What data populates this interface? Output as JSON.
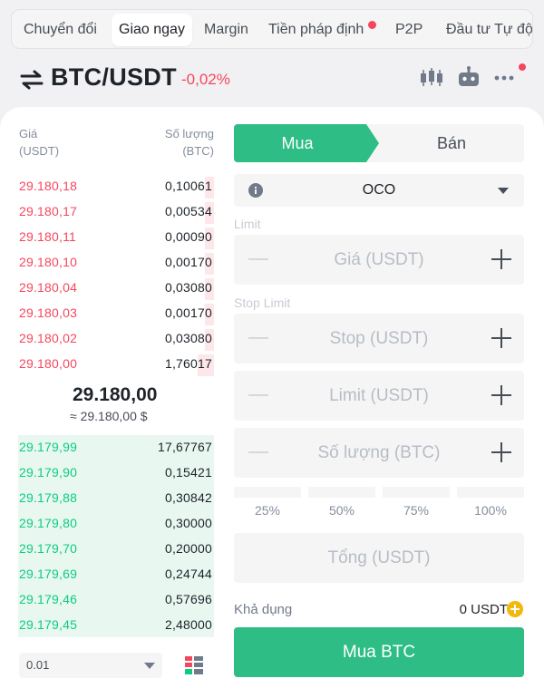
{
  "tabs": [
    {
      "label": "Chuyển đổi",
      "active": false
    },
    {
      "label": "Giao ngay",
      "active": true
    },
    {
      "label": "Margin",
      "active": false
    },
    {
      "label": "Tiền pháp định",
      "active": false,
      "badge": true
    },
    {
      "label": "P2P",
      "active": false
    },
    {
      "label": "Đầu tư Tự độ",
      "active": false
    }
  ],
  "header": {
    "pair": "BTC/USDT",
    "change": "-0,02%",
    "icons": [
      "candlestick-chart-icon",
      "bot-icon",
      "more-icon"
    ]
  },
  "orderbook": {
    "price_header": [
      "Giá",
      "(USDT)"
    ],
    "qty_header": [
      "Số lượng",
      "(BTC)"
    ],
    "asks": [
      {
        "price": "29.180,18",
        "qty": "0,10061"
      },
      {
        "price": "29.180,17",
        "qty": "0,00534"
      },
      {
        "price": "29.180,11",
        "qty": "0,00090"
      },
      {
        "price": "29.180,10",
        "qty": "0,00170"
      },
      {
        "price": "29.180,04",
        "qty": "0,03080"
      },
      {
        "price": "29.180,03",
        "qty": "0,00170"
      },
      {
        "price": "29.180,02",
        "qty": "0,03080"
      },
      {
        "price": "29.180,00",
        "qty": "1,76017"
      }
    ],
    "last_price": "29.180,00",
    "last_price_usd": "≈ 29.180,00 $",
    "bids": [
      {
        "price": "29.179,99",
        "qty": "17,67767"
      },
      {
        "price": "29.179,90",
        "qty": "0,15421"
      },
      {
        "price": "29.179,88",
        "qty": "0,30842"
      },
      {
        "price": "29.179,80",
        "qty": "0,30000"
      },
      {
        "price": "29.179,70",
        "qty": "0,20000"
      },
      {
        "price": "29.179,69",
        "qty": "0,24744"
      },
      {
        "price": "29.179,46",
        "qty": "0,57696"
      },
      {
        "price": "29.179,45",
        "qty": "2,48000"
      }
    ],
    "depth_value": "0.01"
  },
  "trade": {
    "buy_tab": "Mua",
    "sell_tab": "Bán",
    "order_type": "OCO",
    "limit_section": "Limit",
    "price_placeholder": "Giá (USDT)",
    "stop_limit_section": "Stop Limit",
    "stop_placeholder": "Stop (USDT)",
    "limit_placeholder": "Limit (USDT)",
    "qty_placeholder": "Số lượng (BTC)",
    "percents": [
      "25%",
      "50%",
      "75%",
      "100%"
    ],
    "total_placeholder": "Tổng (USDT)",
    "available_label": "Khả dụng",
    "available_value": "0 USDT",
    "buy_button": "Mua BTC"
  },
  "colors": {
    "buy": "#2ebd85",
    "sell": "#f6465d",
    "accent": "#f0b90b"
  }
}
